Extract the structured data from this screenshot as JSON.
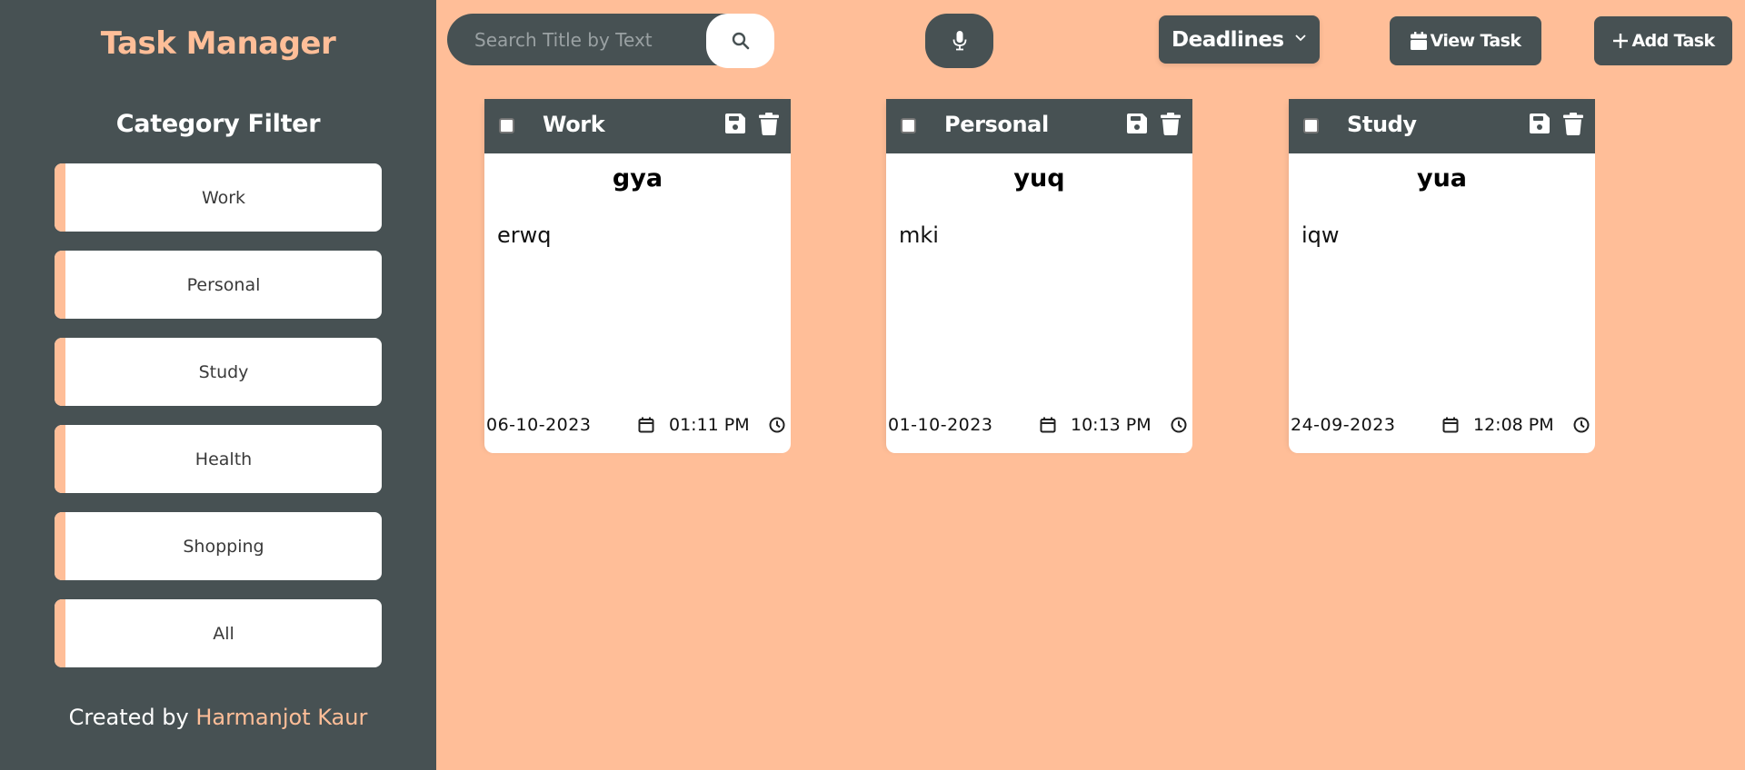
{
  "app": {
    "title": "Task Manager"
  },
  "colors": {
    "accent": "#FFBE98",
    "dark": "#475153",
    "card": "#FFFFFF"
  },
  "sidebar": {
    "heading": "Category Filter",
    "filters": [
      {
        "label": "Work"
      },
      {
        "label": "Personal"
      },
      {
        "label": "Study"
      },
      {
        "label": "Health"
      },
      {
        "label": "Shopping"
      },
      {
        "label": "All"
      }
    ],
    "footer": {
      "prefix": "Created by",
      "author": "Harmanjot Kaur"
    }
  },
  "toolbar": {
    "search": {
      "placeholder": "Search Title by Text",
      "value": "",
      "button_icon": "search-icon"
    },
    "mic_icon": "microphone-icon",
    "sort_select": {
      "selected": "Deadlines",
      "icon": "chevron-down-icon"
    },
    "view_task": {
      "label": "View Task",
      "icon": "calendar-icon"
    },
    "add_task": {
      "label": "Add Task",
      "icon": "plus-icon"
    }
  },
  "tasks": [
    {
      "category": "Work",
      "title": "gya",
      "description": "erwq",
      "date": "06-10-2023",
      "time": "01:11 PM",
      "checked": false
    },
    {
      "category": "Personal",
      "title": "yuq",
      "description": "mki",
      "date": "01-10-2023",
      "time": "10:13 PM",
      "checked": false
    },
    {
      "category": "Study",
      "title": "yua",
      "description": "iqw",
      "date": "24-09-2023",
      "time": "12:08 PM",
      "checked": false
    }
  ]
}
